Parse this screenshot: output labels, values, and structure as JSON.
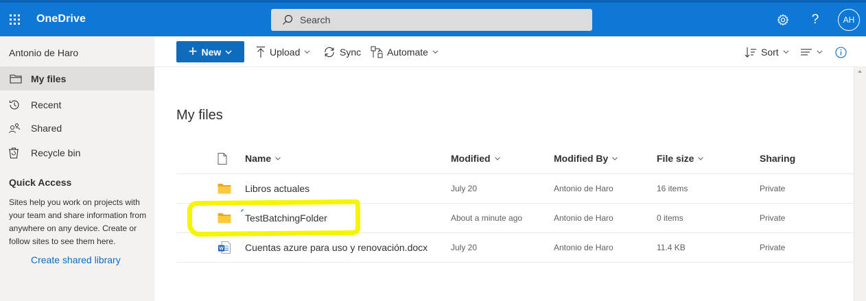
{
  "app": {
    "name": "OneDrive",
    "user_initials": "AH"
  },
  "search": {
    "placeholder": "Search"
  },
  "nav": {
    "user_name": "Antonio de Haro",
    "items": [
      {
        "label": "My files",
        "icon": "folder-icon",
        "selected": true
      },
      {
        "label": "Recent",
        "icon": "history-icon"
      },
      {
        "label": "Shared",
        "icon": "people-icon"
      },
      {
        "label": "Recycle bin",
        "icon": "trash-icon"
      }
    ],
    "quick_access": {
      "title": "Quick Access",
      "description": "Sites help you work on projects with your team and share information from anywhere on any device. Create or follow sites to see them here.",
      "create_link": "Create shared library"
    }
  },
  "toolbar": {
    "new_label": "New",
    "upload_label": "Upload",
    "sync_label": "Sync",
    "automate_label": "Automate",
    "sort_label": "Sort"
  },
  "main": {
    "title": "My files",
    "columns": {
      "name": "Name",
      "modified": "Modified",
      "modified_by": "Modified By",
      "file_size": "File size",
      "sharing": "Sharing"
    },
    "rows": [
      {
        "type": "folder",
        "name": "Libros actuales",
        "modified": "July 20",
        "modified_by": "Antonio de Haro",
        "file_size": "16 items",
        "sharing": "Private"
      },
      {
        "type": "folder",
        "name": "TestBatchingFolder",
        "modified": "About a minute ago",
        "modified_by": "Antonio de Haro",
        "file_size": "0 items",
        "sharing": "Private",
        "new": true,
        "highlighted": true
      },
      {
        "type": "word-doc",
        "name": "Cuentas azure para uso y renovación.docx",
        "modified": "July 20",
        "modified_by": "Antonio de Haro",
        "file_size": "11.4 KB",
        "sharing": "Private"
      }
    ]
  },
  "colors": {
    "suite_bar": "#0f78d4",
    "accent": "#0f6cbd",
    "nav_bg": "#f3f2f1",
    "highlight": "#f5f500",
    "folder": "#ffc83d"
  }
}
